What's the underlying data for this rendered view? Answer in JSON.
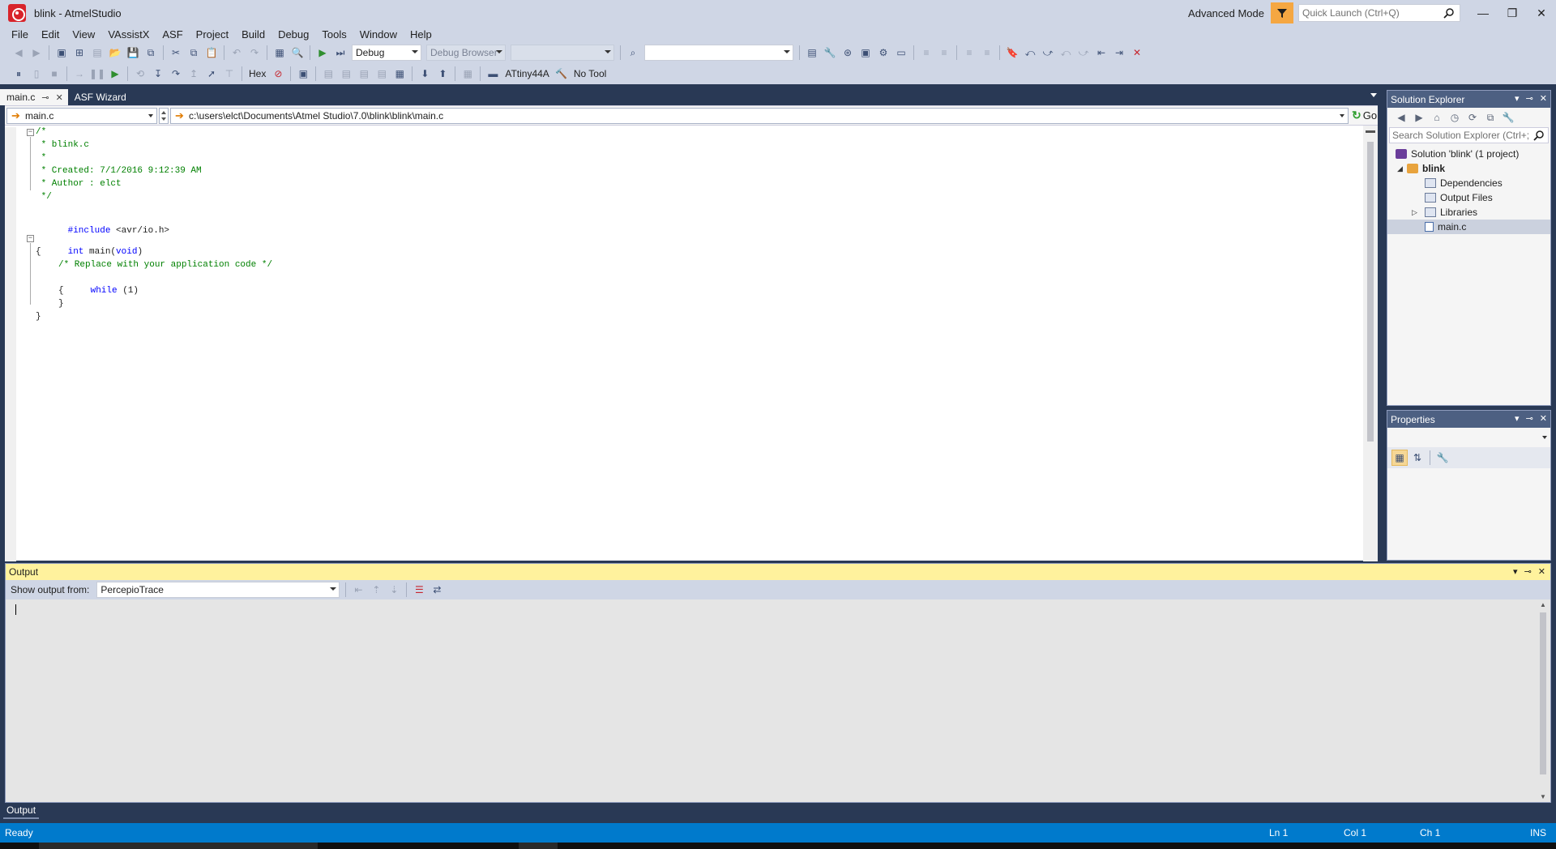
{
  "window": {
    "title": "blink - AtmelStudio",
    "mode": "Advanced Mode",
    "quick_launch_placeholder": "Quick Launch (Ctrl+Q)",
    "controls": [
      "—",
      "❐",
      "✕"
    ]
  },
  "menu": [
    "File",
    "Edit",
    "View",
    "VAssistX",
    "ASF",
    "Project",
    "Build",
    "Debug",
    "Tools",
    "Window",
    "Help"
  ],
  "toolbar1": {
    "config": "Debug",
    "debug_browser": "Debug Browser",
    "platform": "",
    "search_combo": ""
  },
  "toolbar2": {
    "hex_label": "Hex",
    "device": "ATtiny44A",
    "tool": "No Tool"
  },
  "tabs": [
    {
      "label": "main.c",
      "active": true
    },
    {
      "label": "ASF Wizard",
      "active": false
    }
  ],
  "editor": {
    "scope_combo": "main.c",
    "path_combo": "c:\\users\\elct\\Documents\\Atmel Studio\\7.0\\blink\\blink\\main.c",
    "go_label": "Go",
    "lines": [
      {
        "text": "/*",
        "cls": "c-green"
      },
      {
        "text": " * blink.c",
        "cls": "c-green"
      },
      {
        "text": " *",
        "cls": "c-green"
      },
      {
        "text": " * Created: 7/1/2016 9:12:39 AM",
        "cls": "c-green"
      },
      {
        "text": " * Author : elct",
        "cls": "c-green"
      },
      {
        "text": " */",
        "cls": "c-green"
      },
      {
        "text": "",
        "cls": "c-dark"
      },
      {
        "text": "",
        "cls": "c-dark"
      },
      {
        "text": "",
        "cls": "c-dark"
      },
      {
        "text": "",
        "cls": "c-dark"
      },
      {
        "text": "",
        "cls": "c-dark"
      },
      {
        "text": "",
        "cls": "c-dark"
      },
      {
        "text": "",
        "cls": "c-dark"
      },
      {
        "text": "",
        "cls": "c-dark"
      },
      {
        "text": "",
        "cls": "c-dark"
      },
      {
        "text": "",
        "cls": "c-dark"
      }
    ],
    "include_kw": "#include",
    "include_arg": " <avr/io.h>",
    "main_kw": "int",
    "main_mid": " main(",
    "main_void": "void",
    "main_end": ")",
    "brace_open": "{",
    "comment_line": "/* Replace with your application code */",
    "while_kw": "while",
    "while_arg": " (1)",
    "inner_open": "{",
    "inner_close": "}",
    "brace_close": "}"
  },
  "solution_explorer": {
    "title": "Solution Explorer",
    "search_placeholder": "Search Solution Explorer (Ctrl+;",
    "items": [
      {
        "label": "Solution 'blink' (1 project)"
      },
      {
        "label": "blink"
      },
      {
        "label": "Dependencies"
      },
      {
        "label": "Output Files"
      },
      {
        "label": "Libraries"
      },
      {
        "label": "main.c"
      }
    ]
  },
  "properties": {
    "title": "Properties"
  },
  "output": {
    "title": "Output",
    "show_from_label": "Show output from:",
    "source": "PercepioTrace"
  },
  "bottom_tab": "Output",
  "status": {
    "ready": "Ready",
    "ln": "Ln 1",
    "col": "Col 1",
    "ch": "Ch 1",
    "ins": "INS"
  },
  "colors": {
    "accent": "#007acc",
    "chrome": "#cfd6e5",
    "dark_frame": "#293955",
    "output_header": "#fff29d"
  }
}
